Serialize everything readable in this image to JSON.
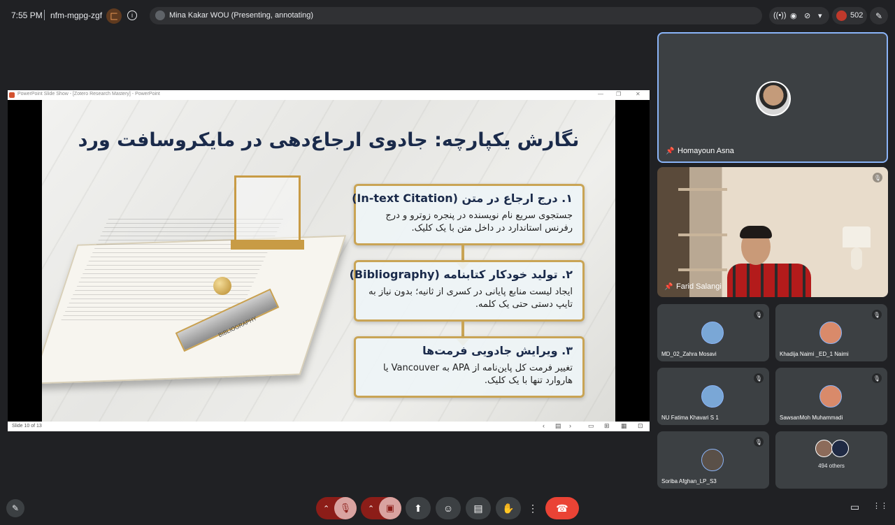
{
  "topbar": {
    "time": "7:55 PM",
    "meeting_code": "nfm-mgpg-zgf",
    "host_badge": "匚",
    "info_icon": "i",
    "presenter_text": "Mina Kakar WOU (Presenting, annotating)",
    "people_count": "502",
    "icons": {
      "broadcast": "((•))",
      "eye": "◉",
      "captions_off": "⊘",
      "dropdown": "▾",
      "pen": "✎"
    }
  },
  "presentation": {
    "window_title": "PowerPoint Slide Show - [Zotero Research Mastery] - PowerPoint",
    "window_controls": {
      "minimize": "—",
      "restore": "❐",
      "close": "✕"
    },
    "slide_number": "Slide 10 of 13",
    "status_icons": {
      "prev": "‹",
      "notes": "▤",
      "next": "›",
      "normal": "▭",
      "sorter": "⊞",
      "reading": "▦",
      "show": "⊡"
    },
    "heading": "نگارش یکپارچه: جادوی ارجاع‌دهی در مایکروسافت ورد",
    "illustration_label": "BIBLIOGRAPHY",
    "cards": [
      {
        "title": "۱. درج ارجاع در متن (In-text Citation)",
        "body": "جستجوی سریع نام نویسنده در پنجره زوترو و درج رفرنس استاندارد در داخل متن با یک کلیک."
      },
      {
        "title": "۲. تولید خودکار کتابنامه (Bibliography)",
        "body": "ایجاد لیست منابع پایانی در کسری از ثانیه؛ بدون نیاز به تایپ دستی حتی یک کلمه."
      },
      {
        "title": "۳. ویرایش جادویی فرمت‌ها",
        "body": "تغییر فرمت کل پاین‌نامه از APA به Vancouver یا هاروارد تنها با یک کلیک."
      }
    ]
  },
  "participants": {
    "speaker": {
      "name": "Homayoun Asna",
      "pin_icon": "📌"
    },
    "video": {
      "name": "Farid Salangi",
      "pin_icon": "📌",
      "mute_icon": "🎙"
    },
    "grid": [
      {
        "name": "MD_02_Zahra Mosavi",
        "mute_icon": "🎙"
      },
      {
        "name": "Khadija Naimi _ED_1 Naimi",
        "mute_icon": "🎙"
      },
      {
        "name": "NU Fatima Khavari S 1",
        "mute_icon": "🎙"
      },
      {
        "name": "SawsanMoh Muhammadi",
        "mute_icon": "🎙"
      },
      {
        "name": "Soriba Afghan_LP_S3",
        "mute_icon": "🎙"
      }
    ],
    "others_label": "494 others"
  },
  "bottombar": {
    "pen_off": "✎",
    "chevron": "⌃",
    "mic_off": "🎙",
    "cam_off": "▣",
    "present": "⬆",
    "emoji": "☺",
    "captions": "▤",
    "hand": "✋",
    "more": "⋮",
    "end_call": "☎",
    "chat": "▭",
    "activities": "⋮⋮"
  },
  "colors": {
    "accent": "#8ab4f8",
    "end_call": "#ea4335",
    "muted_red": "#8c1d18",
    "gold": "#c9a455"
  }
}
